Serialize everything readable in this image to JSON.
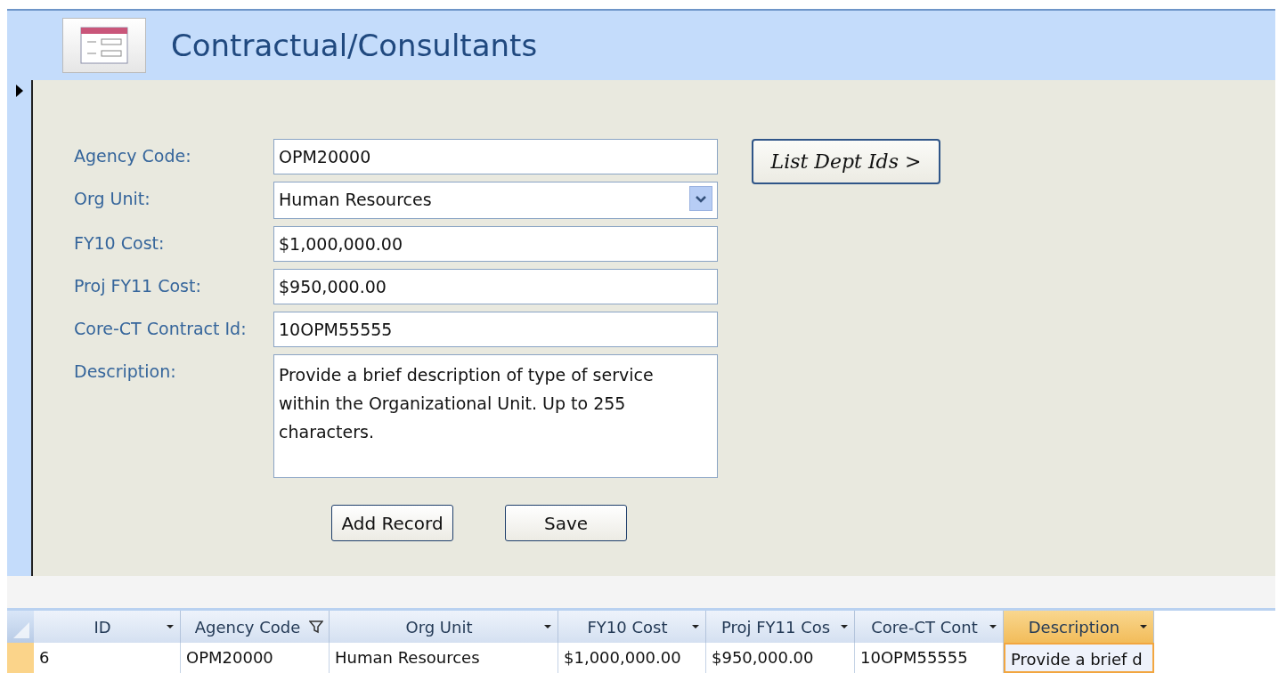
{
  "form": {
    "title": "Contractual/Consultants",
    "fields": [
      {
        "label": "Agency Code:",
        "kind": "text",
        "value": "OPM20000"
      },
      {
        "label": "Org Unit:",
        "kind": "combo",
        "value": "Human Resources"
      },
      {
        "label": "FY10 Cost:",
        "kind": "text",
        "value": "$1,000,000.00"
      },
      {
        "label": "Proj FY11 Cost:",
        "kind": "text",
        "value": "$950,000.00"
      },
      {
        "label": "Core-CT Contract Id:",
        "kind": "text",
        "value": "10OPM55555"
      },
      {
        "label": "Description:",
        "kind": "textarea",
        "value": "Provide a brief description of type of service within the Organizational Unit. Up to 255 characters."
      }
    ],
    "side_button": "List Dept Ids >",
    "buttons": [
      "Add Record",
      "Save"
    ]
  },
  "datasheet": {
    "columns": [
      {
        "label": "ID",
        "filtered": false,
        "selected": false
      },
      {
        "label": "Agency Code",
        "filtered": true,
        "selected": false
      },
      {
        "label": "Org Unit",
        "filtered": false,
        "selected": false
      },
      {
        "label": "FY10 Cost",
        "filtered": false,
        "selected": false
      },
      {
        "label": "Proj FY11 Cos",
        "filtered": false,
        "selected": false
      },
      {
        "label": "Core-CT Cont",
        "filtered": false,
        "selected": false
      },
      {
        "label": "Description",
        "filtered": false,
        "selected": true
      }
    ],
    "rows": [
      {
        "cells": [
          "6",
          "OPM20000",
          "Human Resources",
          "$1,000,000.00",
          "$950,000.00",
          "10OPM55555",
          "Provide a brief d"
        ]
      }
    ]
  }
}
